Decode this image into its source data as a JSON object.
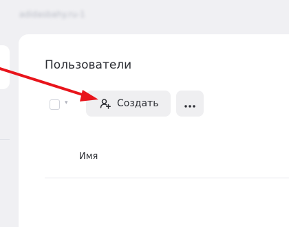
{
  "header": {
    "blurred_title": "adidasbahy.ru-1"
  },
  "panel": {
    "title": "Пользователи"
  },
  "toolbar": {
    "dropdown_caret": "▾",
    "create_label": "Создать",
    "more_icon": "more-horizontal-icon"
  },
  "table": {
    "columns": [
      "Имя"
    ]
  },
  "colors": {
    "background": "#f0f0f3",
    "card": "#ffffff",
    "button_bg": "#efeff1",
    "text": "#2b2d33",
    "annotation_arrow": "#e8141b"
  }
}
